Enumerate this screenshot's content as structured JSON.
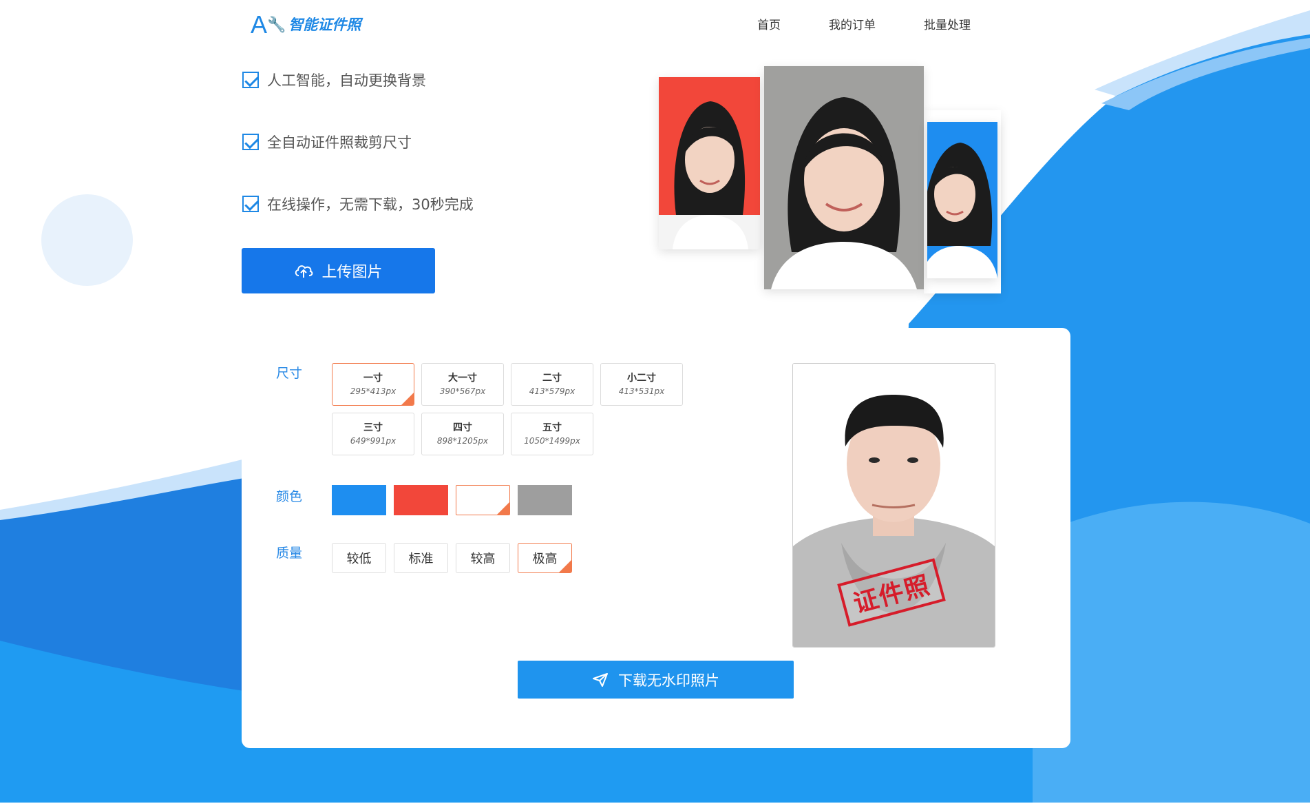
{
  "header": {
    "logo_ai": "AI",
    "logo_text": "智能证件照",
    "nav": [
      "首页",
      "我的订单",
      "批量处理"
    ]
  },
  "hero": {
    "features": [
      "人工智能，自动更换背景",
      "全自动证件照裁剪尺寸",
      "在线操作，无需下载，30秒完成"
    ],
    "upload_label": "上传图片"
  },
  "editor": {
    "size_label": "尺寸",
    "sizes": [
      {
        "name": "一寸",
        "px": "295*413px",
        "selected": true
      },
      {
        "name": "大一寸",
        "px": "390*567px",
        "selected": false
      },
      {
        "name": "二寸",
        "px": "413*579px",
        "selected": false
      },
      {
        "name": "小二寸",
        "px": "413*531px",
        "selected": false
      },
      {
        "name": "三寸",
        "px": "649*991px",
        "selected": false
      },
      {
        "name": "四寸",
        "px": "898*1205px",
        "selected": false
      },
      {
        "name": "五寸",
        "px": "1050*1499px",
        "selected": false
      }
    ],
    "color_label": "颜色",
    "colors": [
      "#1e8ef0",
      "#f2473a",
      "#ffffff",
      "#9e9e9e"
    ],
    "selected_color_index": 2,
    "quality_label": "质量",
    "qualities": [
      "较低",
      "标准",
      "较高",
      "极高"
    ],
    "selected_quality_index": 3,
    "stamp_text": "证件照",
    "download_label": "下载无水印照片"
  },
  "theme": {
    "primary": "#1677ea",
    "accent": "#f2794a",
    "wave": "#1e9af0"
  }
}
